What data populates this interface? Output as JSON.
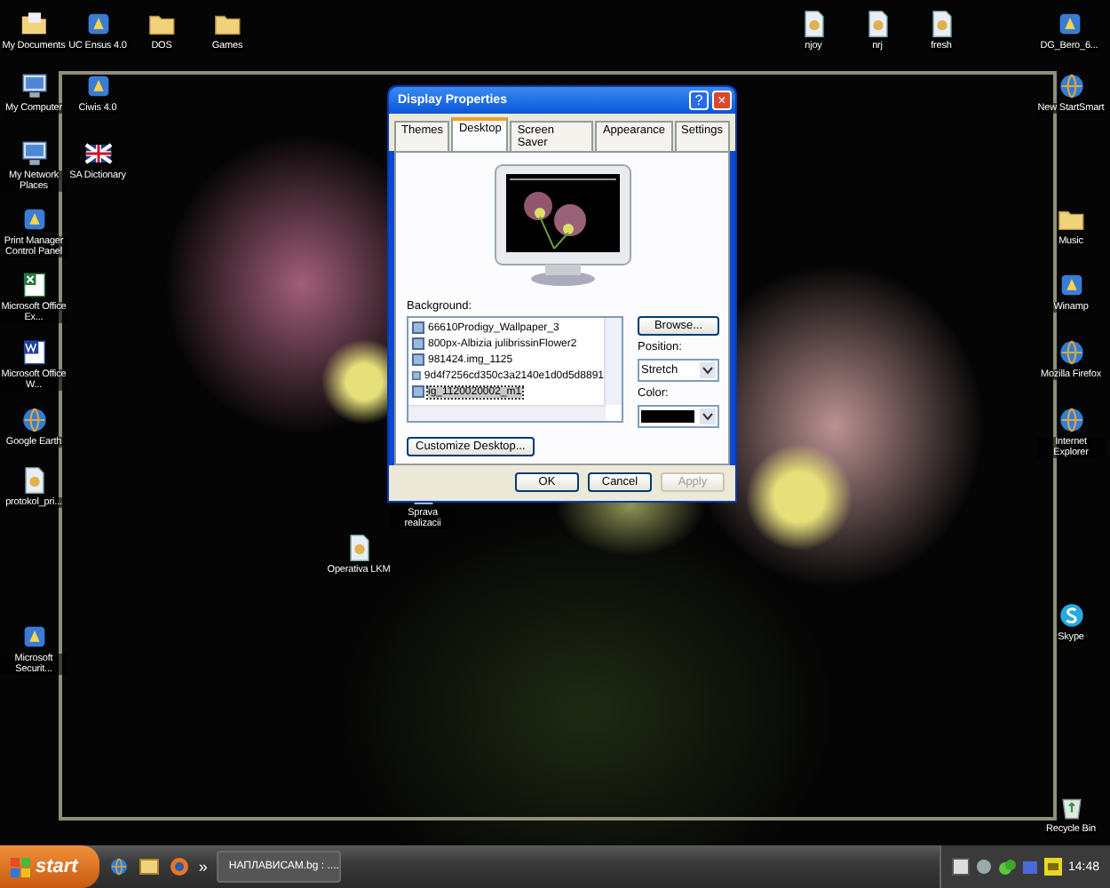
{
  "desktop_icons": [
    {
      "label": "My Documents",
      "kind": "documents"
    },
    {
      "label": "UC Ensus 4.0",
      "kind": "app"
    },
    {
      "label": "DOS",
      "kind": "folder"
    },
    {
      "label": "Games",
      "kind": "folder"
    },
    {
      "label": "njoy",
      "kind": "file"
    },
    {
      "label": "nrj",
      "kind": "file"
    },
    {
      "label": "fresh",
      "kind": "file"
    },
    {
      "label": "DG_Bero_6...",
      "kind": "app"
    },
    {
      "label": "My Computer",
      "kind": "computer"
    },
    {
      "label": "Ciwis 4.0",
      "kind": "app"
    },
    {
      "label": "New StartSmart",
      "kind": "globe"
    },
    {
      "label": "My Network Places",
      "kind": "computer"
    },
    {
      "label": "SA Dictionary",
      "kind": "flag"
    },
    {
      "label": "Print Manager Control Panel",
      "kind": "app"
    },
    {
      "label": "Music",
      "kind": "folder"
    },
    {
      "label": "Microsoft Office Ex...",
      "kind": "excel"
    },
    {
      "label": "Winamp",
      "kind": "app"
    },
    {
      "label": "Microsoft Office W...",
      "kind": "word"
    },
    {
      "label": "Mozilla Firefox",
      "kind": "globe"
    },
    {
      "label": "Google Earth",
      "kind": "globe"
    },
    {
      "label": "Internet Explorer",
      "kind": "globe"
    },
    {
      "label": "protokol_pri...",
      "kind": "file"
    },
    {
      "label": "Sprava realizacii",
      "kind": "file"
    },
    {
      "label": "Operativa LKM",
      "kind": "file"
    },
    {
      "label": "Skype",
      "kind": "skype"
    },
    {
      "label": "Microsoft Securit...",
      "kind": "app"
    },
    {
      "label": "Recycle Bin",
      "kind": "bin"
    }
  ],
  "dialog": {
    "title": "Display Properties",
    "help": "?",
    "close": "×",
    "tabs": [
      {
        "label": "Themes",
        "selected": false
      },
      {
        "label": "Desktop",
        "selected": true
      },
      {
        "label": "Screen Saver",
        "selected": false
      },
      {
        "label": "Appearance",
        "selected": false
      },
      {
        "label": "Settings",
        "selected": false
      }
    ],
    "background_label": "Background:",
    "backgrounds": [
      {
        "name": "66610Prodigy_Wallpaper_3",
        "selected": false
      },
      {
        "name": "800px-Albizia julibrissinFlower2",
        "selected": false
      },
      {
        "name": "981424.img_1125",
        "selected": false
      },
      {
        "name": "9d4f7256cd350c3a2140e1d0d5d8891",
        "selected": false
      },
      {
        "name": "ig_1120020002_m1",
        "selected": true
      }
    ],
    "browse": "Browse...",
    "position_label": "Position:",
    "position": "Stretch",
    "color_label": "Color:",
    "color": "#000000",
    "customize": "Customize Desktop...",
    "buttons": [
      {
        "label": "OK",
        "disabled": false
      },
      {
        "label": "Cancel",
        "disabled": false
      },
      {
        "label": "Apply",
        "disabled": true
      }
    ]
  },
  "taskbar": {
    "start": "start",
    "more": "»",
    "tasks": [
      {
        "label": "НАПЛАВИСАМ.bg : ...."
      }
    ],
    "clock": "14:48"
  }
}
